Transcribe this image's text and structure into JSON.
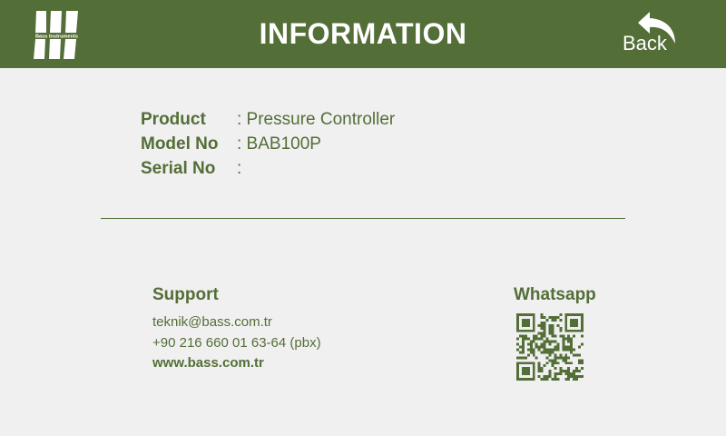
{
  "header": {
    "title": "INFORMATION",
    "back_label": "Back",
    "logo_text": "Bass Instruments",
    "background_color": "#536e37",
    "text_color": "#ffffff",
    "icons": {
      "logo": "bass-instruments-logo",
      "back": "back-arrow-icon"
    }
  },
  "info": {
    "rows": [
      {
        "label": "Product",
        "value": ": Pressure Controller"
      },
      {
        "label": "Model No",
        "value": ": BAB100P"
      },
      {
        "label": "Serial No",
        "value": ":"
      }
    ]
  },
  "support": {
    "title": "Support",
    "email": "teknik@bass.com.tr",
    "phone": "+90 216 660 01 63-64 (pbx)",
    "website": "www.bass.com.tr"
  },
  "whatsapp": {
    "title": "Whatsapp",
    "icon": "qr-code"
  },
  "colors": {
    "accent": "#536e37",
    "background": "#f0f0f0"
  }
}
